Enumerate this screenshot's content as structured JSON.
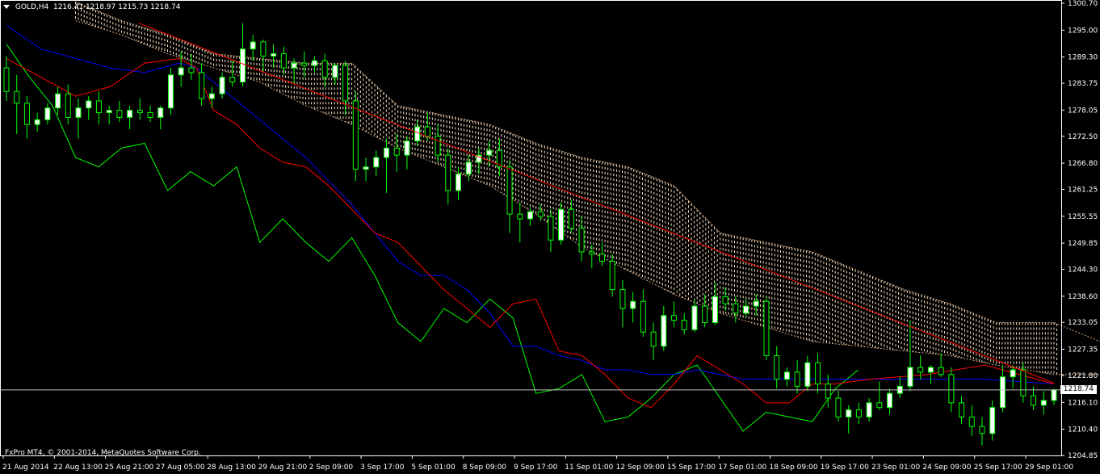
{
  "header": {
    "symbol": "GOLD,H4",
    "ohlc": "1216.41 1218.97 1215.73 1218.74"
  },
  "copyright": "FxPro MT4, © 2001-2014, MetaQuotes Software Corp.",
  "current_price_label": "1218.74",
  "colors": {
    "background": "#000000",
    "bull_candle": "#ffffff",
    "bear_candle": "#000000",
    "wick": "#00ff00",
    "tenkan": "#ff0000",
    "kijun": "#0000ff",
    "chikou": "#00ff00",
    "cloud": "#ffe4c4",
    "trendline": "#ff0000",
    "axis": "#ffffff"
  },
  "chart_data": {
    "type": "candlestick",
    "ylim": [
      1204.85,
      1300.7
    ],
    "y_ticks": [
      1300.7,
      1295.0,
      1289.3,
      1283.75,
      1278.05,
      1272.5,
      1266.8,
      1261.25,
      1255.55,
      1249.85,
      1244.3,
      1238.6,
      1233.05,
      1227.35,
      1221.8,
      1216.1,
      1210.4,
      1204.85
    ],
    "x_labels": [
      "21 Aug 2014",
      "22 Aug 13:00",
      "25 Aug 21:00",
      "27 Aug 05:00",
      "28 Aug 13:00",
      "29 Aug 21:00",
      "2 Sep 09:00",
      "3 Sep 17:00",
      "5 Sep 01:00",
      "8 Sep 09:00",
      "9 Sep 17:00",
      "11 Sep 01:00",
      "12 Sep 09:00",
      "15 Sep 17:00",
      "17 Sep 01:00",
      "18 Sep 09:00",
      "19 Sep 17:00",
      "23 Sep 01:00",
      "24 Sep 09:00",
      "25 Sep 17:00",
      "29 Sep 01:00"
    ],
    "last_price": 1218.74,
    "trendline": {
      "from": [
        23,
        1296.5
      ],
      "to": [
        182,
        1220.2
      ]
    },
    "candles": [
      [
        1287.0,
        1289.5,
        1280.0,
        1282.0
      ],
      [
        1282.0,
        1285.5,
        1273.0,
        1279.5
      ],
      [
        1279.5,
        1281.0,
        1272.0,
        1275.0
      ],
      [
        1275.0,
        1277.5,
        1273.5,
        1276.0
      ],
      [
        1276.0,
        1279.5,
        1275.0,
        1278.5
      ],
      [
        1278.5,
        1283.0,
        1277.0,
        1281.5
      ],
      [
        1281.5,
        1283.5,
        1275.0,
        1276.5
      ],
      [
        1276.5,
        1280.5,
        1272.0,
        1278.5
      ],
      [
        1278.5,
        1281.0,
        1276.0,
        1280.0
      ],
      [
        1280.0,
        1282.0,
        1275.0,
        1277.5
      ],
      [
        1277.5,
        1279.0,
        1275.0,
        1278.0
      ],
      [
        1278.0,
        1280.0,
        1275.5,
        1276.5
      ],
      [
        1276.5,
        1279.0,
        1274.0,
        1278.0
      ],
      [
        1278.0,
        1280.5,
        1276.0,
        1277.5
      ],
      [
        1277.5,
        1279.0,
        1275.5,
        1276.5
      ],
      [
        1276.5,
        1279.0,
        1274.0,
        1278.5
      ],
      [
        1278.5,
        1287.0,
        1277.0,
        1285.5
      ],
      [
        1285.5,
        1290.5,
        1283.0,
        1287.0
      ],
      [
        1287.0,
        1290.0,
        1284.5,
        1286.0
      ],
      [
        1286.0,
        1288.0,
        1279.0,
        1280.5
      ],
      [
        1280.5,
        1283.0,
        1278.5,
        1281.5
      ],
      [
        1281.5,
        1286.0,
        1280.5,
        1285.0
      ],
      [
        1285.0,
        1288.5,
        1283.0,
        1284.0
      ],
      [
        1284.0,
        1296.5,
        1283.0,
        1291.0
      ],
      [
        1291.0,
        1294.0,
        1288.5,
        1292.5
      ],
      [
        1292.5,
        1293.0,
        1286.0,
        1289.5
      ],
      [
        1289.5,
        1292.0,
        1287.0,
        1290.0
      ],
      [
        1290.0,
        1291.5,
        1285.5,
        1287.0
      ],
      [
        1287.0,
        1289.0,
        1283.5,
        1288.0
      ],
      [
        1288.0,
        1290.5,
        1285.0,
        1287.5
      ],
      [
        1287.5,
        1289.5,
        1286.0,
        1288.5
      ],
      [
        1288.5,
        1290.0,
        1283.0,
        1285.0
      ],
      [
        1285.0,
        1288.0,
        1283.5,
        1287.5
      ],
      [
        1287.5,
        1288.5,
        1277.0,
        1280.0
      ],
      [
        1280.0,
        1282.0,
        1263.0,
        1265.5
      ],
      [
        1265.5,
        1268.0,
        1263.0,
        1266.0
      ],
      [
        1266.0,
        1269.5,
        1264.0,
        1268.0
      ],
      [
        1268.0,
        1272.0,
        1260.5,
        1270.0
      ],
      [
        1270.0,
        1273.0,
        1265.0,
        1268.5
      ],
      [
        1268.5,
        1272.5,
        1265.5,
        1271.5
      ],
      [
        1271.5,
        1276.0,
        1270.5,
        1274.5
      ],
      [
        1274.5,
        1277.5,
        1271.5,
        1272.5
      ],
      [
        1272.5,
        1275.0,
        1267.0,
        1268.5
      ],
      [
        1268.5,
        1270.0,
        1258.0,
        1261.0
      ],
      [
        1261.0,
        1266.0,
        1259.0,
        1264.5
      ],
      [
        1264.5,
        1268.5,
        1263.0,
        1267.0
      ],
      [
        1267.0,
        1270.0,
        1264.5,
        1268.5
      ],
      [
        1268.5,
        1271.5,
        1266.0,
        1269.5
      ],
      [
        1269.5,
        1272.0,
        1264.0,
        1266.0
      ],
      [
        1266.0,
        1267.5,
        1252.0,
        1256.0
      ],
      [
        1256.0,
        1258.5,
        1250.0,
        1255.0
      ],
      [
        1255.0,
        1257.5,
        1253.5,
        1256.5
      ],
      [
        1256.5,
        1258.0,
        1254.5,
        1255.5
      ],
      [
        1255.5,
        1257.0,
        1248.0,
        1250.5
      ],
      [
        1250.5,
        1258.5,
        1249.5,
        1257.0
      ],
      [
        1257.0,
        1259.0,
        1252.0,
        1253.0
      ],
      [
        1253.0,
        1255.5,
        1246.0,
        1248.0
      ],
      [
        1248.0,
        1249.5,
        1244.5,
        1247.5
      ],
      [
        1247.5,
        1250.0,
        1245.0,
        1246.0
      ],
      [
        1246.0,
        1247.5,
        1238.5,
        1240.0
      ],
      [
        1240.0,
        1242.0,
        1232.0,
        1236.0
      ],
      [
        1236.0,
        1239.5,
        1233.0,
        1237.5
      ],
      [
        1237.5,
        1240.0,
        1230.0,
        1231.0
      ],
      [
        1231.0,
        1233.0,
        1225.0,
        1228.0
      ],
      [
        1228.0,
        1236.5,
        1227.0,
        1234.5
      ],
      [
        1234.5,
        1237.5,
        1232.0,
        1233.5
      ],
      [
        1233.5,
        1235.0,
        1230.5,
        1231.5
      ],
      [
        1231.5,
        1238.0,
        1231.0,
        1236.5
      ],
      [
        1236.5,
        1239.0,
        1232.0,
        1233.0
      ],
      [
        1233.0,
        1241.5,
        1232.5,
        1238.5
      ],
      [
        1238.5,
        1240.5,
        1235.5,
        1237.0
      ],
      [
        1237.0,
        1238.5,
        1233.0,
        1235.0
      ],
      [
        1235.0,
        1238.0,
        1234.0,
        1236.5
      ],
      [
        1236.5,
        1239.0,
        1234.5,
        1237.5
      ],
      [
        1237.5,
        1238.5,
        1225.0,
        1226.0
      ],
      [
        1226.0,
        1228.0,
        1219.0,
        1221.0
      ],
      [
        1221.0,
        1223.5,
        1219.5,
        1222.5
      ],
      [
        1222.5,
        1225.0,
        1218.0,
        1219.5
      ],
      [
        1219.5,
        1226.0,
        1218.5,
        1224.5
      ],
      [
        1224.5,
        1226.5,
        1218.0,
        1220.0
      ],
      [
        1220.0,
        1222.0,
        1215.0,
        1217.0
      ],
      [
        1217.0,
        1218.5,
        1212.0,
        1213.0
      ],
      [
        1213.0,
        1215.5,
        1209.5,
        1214.5
      ],
      [
        1214.5,
        1216.0,
        1211.5,
        1213.0
      ],
      [
        1213.0,
        1217.0,
        1212.0,
        1216.0
      ],
      [
        1216.0,
        1220.5,
        1214.5,
        1215.0
      ],
      [
        1215.0,
        1219.0,
        1213.5,
        1218.0
      ],
      [
        1218.0,
        1221.5,
        1217.0,
        1219.5
      ],
      [
        1219.5,
        1233.5,
        1218.5,
        1223.5
      ],
      [
        1223.5,
        1226.0,
        1221.0,
        1222.5
      ],
      [
        1222.5,
        1224.0,
        1220.0,
        1223.5
      ],
      [
        1223.5,
        1226.5,
        1221.5,
        1222.0
      ],
      [
        1222.0,
        1223.5,
        1214.0,
        1216.0
      ],
      [
        1216.0,
        1217.5,
        1211.5,
        1213.0
      ],
      [
        1213.0,
        1215.5,
        1209.0,
        1211.0
      ],
      [
        1211.0,
        1213.0,
        1207.0,
        1209.5
      ],
      [
        1209.5,
        1216.5,
        1208.0,
        1215.0
      ],
      [
        1215.0,
        1224.0,
        1214.0,
        1221.5
      ],
      [
        1221.5,
        1224.0,
        1219.0,
        1223.0
      ],
      [
        1223.0,
        1224.5,
        1216.0,
        1217.5
      ],
      [
        1217.5,
        1219.5,
        1214.5,
        1215.5
      ],
      [
        1215.5,
        1218.5,
        1213.5,
        1216.5
      ],
      [
        1216.5,
        1219.0,
        1215.5,
        1218.74
      ]
    ],
    "candle_x0": 0,
    "candle_x1": 182,
    "tenkan": [
      [
        0,
        1289
      ],
      [
        6,
        1285
      ],
      [
        12,
        1281
      ],
      [
        18,
        1283
      ],
      [
        24,
        1288
      ],
      [
        30,
        1289
      ],
      [
        33,
        1287
      ],
      [
        36,
        1278
      ],
      [
        40,
        1275
      ],
      [
        44,
        1270
      ],
      [
        48,
        1267
      ],
      [
        52,
        1266
      ],
      [
        56,
        1262
      ],
      [
        60,
        1257
      ],
      [
        64,
        1252
      ],
      [
        68,
        1250
      ],
      [
        72,
        1245
      ],
      [
        76,
        1240
      ],
      [
        80,
        1236
      ],
      [
        84,
        1232
      ],
      [
        88,
        1237
      ],
      [
        92,
        1238
      ],
      [
        96,
        1227
      ],
      [
        100,
        1226
      ],
      [
        104,
        1222
      ],
      [
        108,
        1217
      ],
      [
        112,
        1215
      ],
      [
        116,
        1220
      ],
      [
        120,
        1226
      ],
      [
        124,
        1223
      ],
      [
        128,
        1220
      ],
      [
        132,
        1216
      ],
      [
        136,
        1216
      ],
      [
        140,
        1220
      ],
      [
        144,
        1220
      ],
      [
        150,
        1221
      ],
      [
        160,
        1222
      ],
      [
        170,
        1224
      ],
      [
        182,
        1220
      ]
    ],
    "kijun": [
      [
        0,
        1296
      ],
      [
        6,
        1291
      ],
      [
        12,
        1289
      ],
      [
        18,
        1287
      ],
      [
        24,
        1286
      ],
      [
        30,
        1288
      ],
      [
        33,
        1287
      ],
      [
        36,
        1284
      ],
      [
        40,
        1280
      ],
      [
        44,
        1276
      ],
      [
        48,
        1272
      ],
      [
        52,
        1268
      ],
      [
        56,
        1263
      ],
      [
        60,
        1258
      ],
      [
        64,
        1252
      ],
      [
        68,
        1246
      ],
      [
        72,
        1243
      ],
      [
        76,
        1243
      ],
      [
        80,
        1240
      ],
      [
        84,
        1235
      ],
      [
        88,
        1228
      ],
      [
        92,
        1228
      ],
      [
        96,
        1226
      ],
      [
        100,
        1225
      ],
      [
        104,
        1223
      ],
      [
        108,
        1223
      ],
      [
        112,
        1222
      ],
      [
        116,
        1222
      ],
      [
        120,
        1223
      ],
      [
        124,
        1222
      ],
      [
        128,
        1221
      ],
      [
        132,
        1221
      ],
      [
        140,
        1221
      ],
      [
        150,
        1221
      ],
      [
        160,
        1221
      ],
      [
        170,
        1221
      ],
      [
        182,
        1220
      ]
    ],
    "chikou": [
      [
        0,
        1292
      ],
      [
        4,
        1285
      ],
      [
        8,
        1279
      ],
      [
        12,
        1268
      ],
      [
        16,
        1266
      ],
      [
        20,
        1270
      ],
      [
        24,
        1271
      ],
      [
        28,
        1261
      ],
      [
        32,
        1265
      ],
      [
        36,
        1262
      ],
      [
        40,
        1266
      ],
      [
        44,
        1250
      ],
      [
        48,
        1255
      ],
      [
        52,
        1250
      ],
      [
        56,
        1246
      ],
      [
        60,
        1251
      ],
      [
        64,
        1243
      ],
      [
        68,
        1233
      ],
      [
        72,
        1229
      ],
      [
        76,
        1236
      ],
      [
        80,
        1233
      ],
      [
        84,
        1238
      ],
      [
        88,
        1234
      ],
      [
        92,
        1218
      ],
      [
        96,
        1219
      ],
      [
        100,
        1222
      ],
      [
        104,
        1212
      ],
      [
        108,
        1213
      ],
      [
        112,
        1217
      ],
      [
        116,
        1222
      ],
      [
        120,
        1224
      ],
      [
        124,
        1217
      ],
      [
        128,
        1210
      ],
      [
        132,
        1214
      ],
      [
        136,
        1213
      ],
      [
        140,
        1212
      ],
      [
        144,
        1219
      ],
      [
        148,
        1223
      ]
    ],
    "cloud_a": [
      [
        12,
        1297
      ],
      [
        20,
        1294
      ],
      [
        28,
        1290
      ],
      [
        36,
        1287
      ],
      [
        44,
        1284
      ],
      [
        52,
        1279
      ],
      [
        60,
        1275
      ],
      [
        68,
        1270
      ],
      [
        76,
        1266
      ],
      [
        84,
        1262
      ],
      [
        92,
        1256
      ],
      [
        100,
        1249
      ],
      [
        108,
        1244
      ],
      [
        116,
        1239
      ],
      [
        124,
        1235
      ],
      [
        132,
        1232
      ],
      [
        140,
        1229
      ],
      [
        148,
        1228
      ],
      [
        156,
        1227
      ],
      [
        164,
        1226
      ],
      [
        172,
        1224
      ],
      [
        182,
        1222
      ],
      [
        190,
        1222
      ]
    ],
    "cloud_b": [
      [
        12,
        1301
      ],
      [
        20,
        1297
      ],
      [
        28,
        1294
      ],
      [
        36,
        1290
      ],
      [
        44,
        1289
      ],
      [
        52,
        1288
      ],
      [
        60,
        1288
      ],
      [
        68,
        1279
      ],
      [
        76,
        1277
      ],
      [
        84,
        1275
      ],
      [
        92,
        1271
      ],
      [
        100,
        1268
      ],
      [
        108,
        1266
      ],
      [
        116,
        1262
      ],
      [
        124,
        1252
      ],
      [
        132,
        1250
      ],
      [
        140,
        1248
      ],
      [
        148,
        1244
      ],
      [
        156,
        1240
      ],
      [
        164,
        1237
      ],
      [
        172,
        1233
      ],
      [
        182,
        1233
      ],
      [
        190,
        1229
      ]
    ]
  }
}
